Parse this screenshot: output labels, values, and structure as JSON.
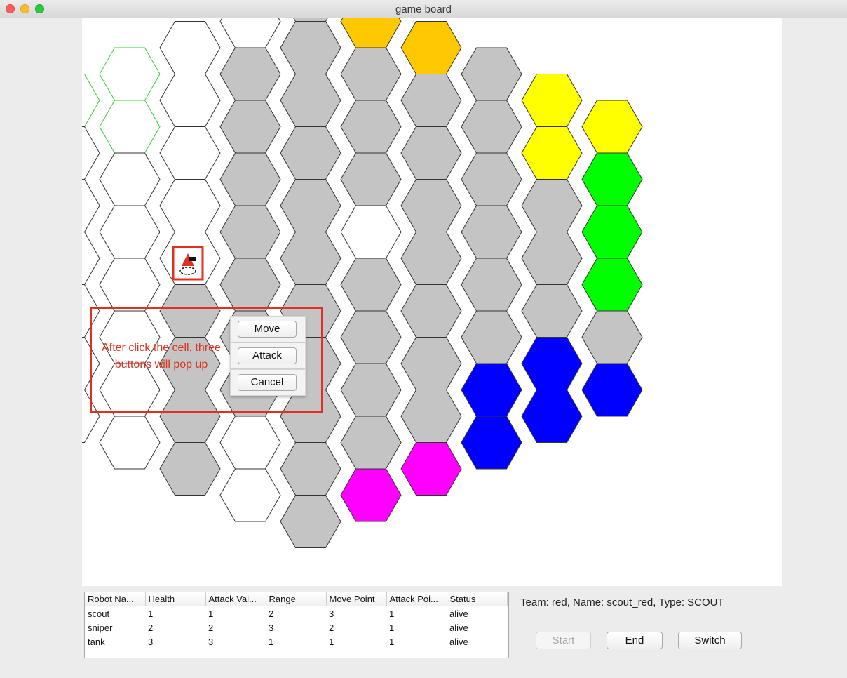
{
  "window": {
    "title": "game board"
  },
  "annotation": {
    "text": "After click the cell, three buttons will pop up"
  },
  "popup_menu": {
    "items": [
      "Move",
      "Attack",
      "Cancel"
    ]
  },
  "colors": {
    "empty": "#ffffff",
    "terrain": "#c4c4c4",
    "selected": "#7b7b7b",
    "orange": "#ffc800",
    "yellow": "#ffff00",
    "green": "#00ff00",
    "blue": "#0000ff",
    "magenta": "#ff00ff",
    "move_range_outline": "#33cc33",
    "robot_red": "#e0301e"
  },
  "robot_table": {
    "columns": [
      "Robot Na...",
      "Health",
      "Attack Val...",
      "Range",
      "Move Point",
      "Attack Poi...",
      "Status"
    ],
    "rows": [
      [
        "scout",
        "1",
        "1",
        "2",
        "3",
        "1",
        "alive"
      ],
      [
        "sniper",
        "2",
        "2",
        "3",
        "2",
        "1",
        "alive"
      ],
      [
        "tank",
        "3",
        "3",
        "1",
        "1",
        "1",
        "alive"
      ]
    ]
  },
  "info": {
    "text": "Team: red,  Name: scout_red, Type: SCOUT"
  },
  "buttons": {
    "start": "Start",
    "end": "End",
    "switch": "Switch"
  }
}
